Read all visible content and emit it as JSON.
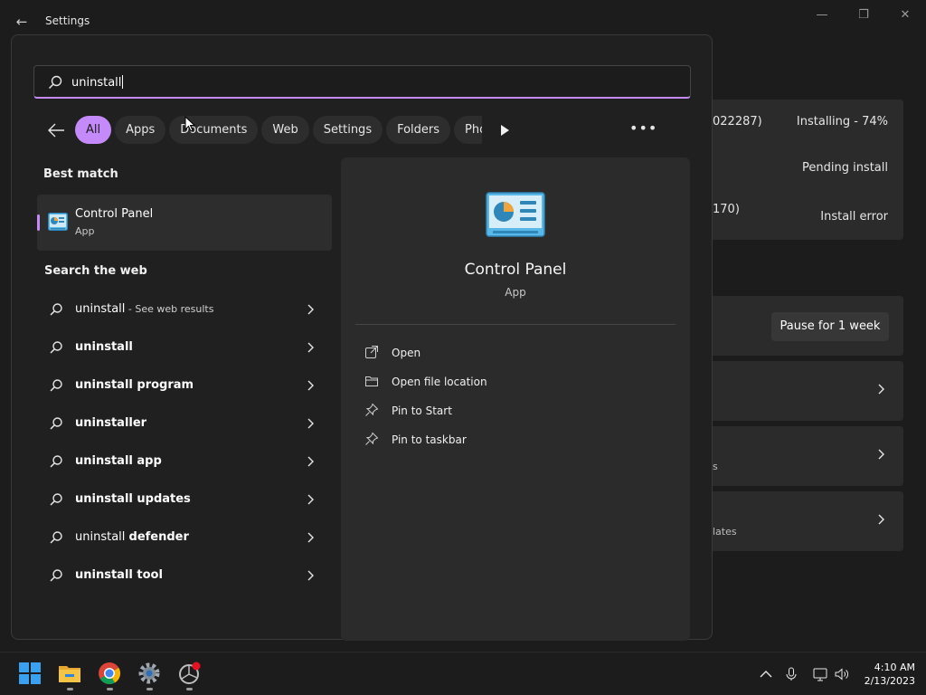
{
  "settings": {
    "title": "Settings",
    "updates": [
      {
        "left": "022287)",
        "right": "Installing - 74%"
      },
      {
        "left": "",
        "right": "Pending install"
      },
      {
        "left": "170)",
        "right": "Install error"
      }
    ],
    "pause_label": "Pause for 1 week",
    "option_subs": [
      "",
      "s",
      "lates"
    ]
  },
  "search": {
    "query": "uninstall"
  },
  "filters": {
    "chips": [
      "All",
      "Apps",
      "Documents",
      "Web",
      "Settings",
      "Folders",
      "Pho"
    ],
    "active": "All"
  },
  "best_match": {
    "heading": "Best match",
    "name": "Control Panel",
    "type": "App"
  },
  "web": {
    "heading": "Search the web",
    "items": [
      {
        "prefix": "uninstall",
        "suffix": "",
        "note": " - See web results"
      },
      {
        "prefix": "",
        "suffix": "uninstall",
        "note": ""
      },
      {
        "prefix": "",
        "suffix": "uninstall program",
        "note": ""
      },
      {
        "prefix": "",
        "suffix": "uninstaller",
        "note": ""
      },
      {
        "prefix": "",
        "suffix": "uninstall app",
        "note": ""
      },
      {
        "prefix": "",
        "suffix": "uninstall updates",
        "note": ""
      },
      {
        "prefix": "uninstall ",
        "suffix": "defender",
        "note": ""
      },
      {
        "prefix": "",
        "suffix": "uninstall tool",
        "note": ""
      }
    ]
  },
  "preview": {
    "name": "Control Panel",
    "type": "App",
    "actions": [
      {
        "icon": "open-icon",
        "label": "Open"
      },
      {
        "icon": "folder-icon",
        "label": "Open file location"
      },
      {
        "icon": "pin-icon",
        "label": "Pin to Start"
      },
      {
        "icon": "pin-icon",
        "label": "Pin to taskbar"
      }
    ]
  },
  "clock": {
    "time": "4:10 AM",
    "date": "2/13/2023"
  },
  "colors": {
    "accent": "#c58af9",
    "background": "#202020"
  }
}
